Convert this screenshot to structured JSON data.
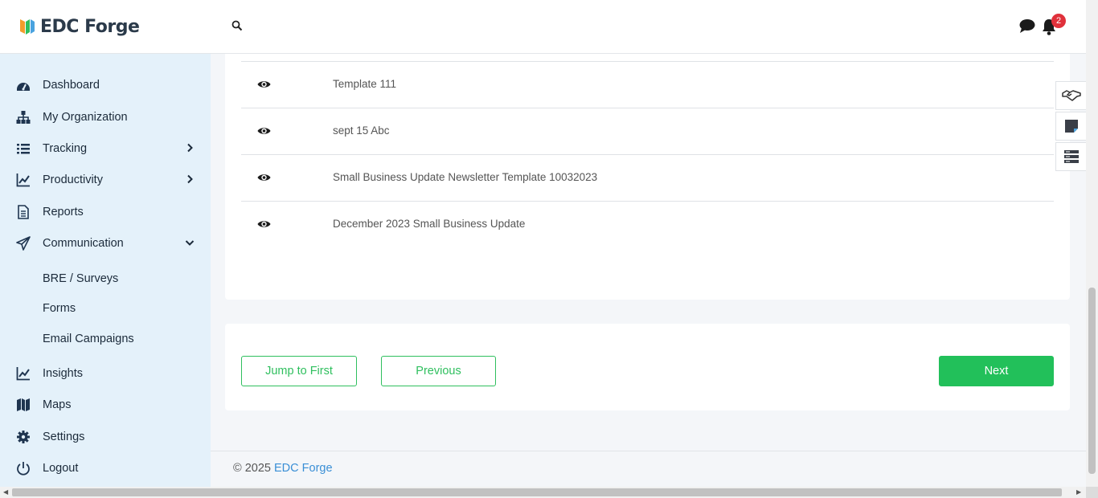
{
  "brand": {
    "name": "EDC Forge"
  },
  "header": {
    "notification_count": "2"
  },
  "sidebar": {
    "items": [
      {
        "label": "Dashboard",
        "icon": "dashboard-icon"
      },
      {
        "label": "My Organization",
        "icon": "org-chart-icon"
      },
      {
        "label": "Tracking",
        "icon": "list-icon",
        "expand": "chevron-right-icon"
      },
      {
        "label": "Productivity",
        "icon": "line-chart-icon",
        "expand": "chevron-right-icon"
      },
      {
        "label": "Reports",
        "icon": "document-icon"
      },
      {
        "label": "Communication",
        "icon": "paper-plane-icon",
        "expand": "chevron-down-icon"
      },
      {
        "label": "Insights",
        "icon": "line-chart-icon"
      },
      {
        "label": "Maps",
        "icon": "map-icon"
      },
      {
        "label": "Settings",
        "icon": "gear-icon"
      },
      {
        "label": "Logout",
        "icon": "power-icon"
      }
    ],
    "sub_items": [
      {
        "label": "BRE / Surveys"
      },
      {
        "label": "Forms"
      },
      {
        "label": "Email Campaigns"
      }
    ]
  },
  "templates": {
    "rows": [
      {
        "name": "Template 111"
      },
      {
        "name": "sept 15 Abc"
      },
      {
        "name": "Small Business Update Newsletter Template 10032023"
      },
      {
        "name": "December 2023 Small Business Update"
      }
    ]
  },
  "pagination": {
    "first_label": "Jump to First",
    "previous_label": "Previous",
    "next_label": "Next"
  },
  "footer": {
    "copyright": "© 2025",
    "link_text": "EDC Forge"
  },
  "colors": {
    "accent_green": "#22c05a",
    "sidebar_bg": "#e4f1fa",
    "badge_red": "#e0313b",
    "link_blue": "#3a8fd6"
  }
}
